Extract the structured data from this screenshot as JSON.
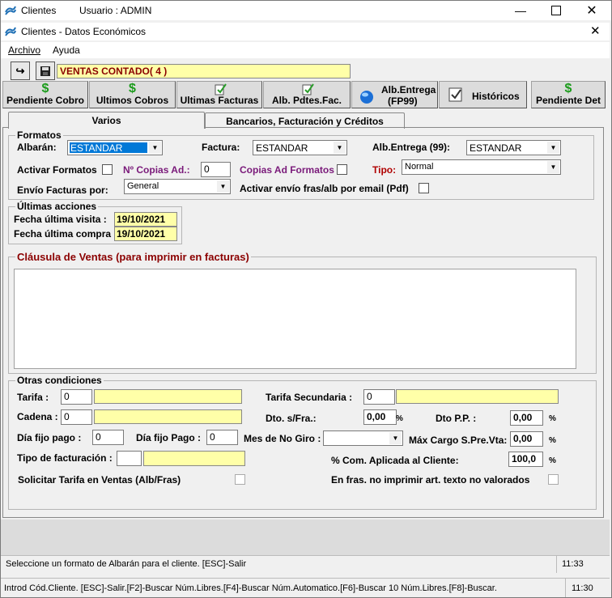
{
  "window": {
    "app_title": "Clientes",
    "user_label": "Usuario : ADMIN",
    "inner_title": "Clientes - Datos Económicos"
  },
  "menu": {
    "archivo": "Archivo",
    "ayuda": "Ayuda"
  },
  "toolbar": {
    "customer_field": "VENTAS CONTADO( 4 )",
    "buttons": {
      "pendiente_cobro": "Pendiente Cobro",
      "ultimos_cobros": "Ultimos Cobros",
      "ultimas_facturas": "Ultimas Facturas",
      "alb_pdtes_fac": "Alb. Pdtes.Fac.",
      "alb_entrega_1": "Alb.Entrega",
      "alb_entrega_2": "(FP99)",
      "historicos": "Históricos",
      "pendiente_det": "Pendiente Det"
    }
  },
  "tabs": {
    "varios": "Varios",
    "bancarios": "Bancarios, Facturación y Créditos"
  },
  "formatos": {
    "legend": "Formatos",
    "albaran_label": "Albarán:",
    "albaran_value": "ESTANDAR",
    "factura_label": "Factura:",
    "factura_value": "ESTANDAR",
    "alb_entrega_label": "Alb.Entrega (99):",
    "alb_entrega_value": "ESTANDAR",
    "activar_formatos_label": "Activar Formatos",
    "copias_label": "Nº Copias Ad.:",
    "copias_value": "0",
    "copias_formatos_label": "Copias Ad Formatos",
    "tipo_label": "Tipo:",
    "tipo_value": "Normal",
    "envio_label": "Envío Facturas por:",
    "envio_value": "General",
    "email_label": "Activar envío fras/alb por email (Pdf)"
  },
  "ultimas": {
    "legend": "Últimas acciones",
    "visita_label": "Fecha última visita :",
    "visita_value": "19/10/2021",
    "compra_label": "Fecha última compra :",
    "compra_value": "19/10/2021"
  },
  "clausula": {
    "legend": "Cláusula de Ventas (para imprimir en facturas)",
    "text": ""
  },
  "otras": {
    "legend": "Otras condiciones",
    "tarifa_label": "Tarifa :",
    "tarifa_value": "0",
    "tarifa_sec_label": "Tarifa Secundaria :",
    "tarifa_sec_value": "0",
    "cadena_label": "Cadena :",
    "cadena_value": "0",
    "dto_fra_label": "Dto. s/Fra.:",
    "dto_fra_value": "0,00",
    "dto_pp_label": "Dto P.P. :",
    "dto_pp_value": "0,00",
    "dia_fijo_pago_label": "Día fijo pago :",
    "dia_fijo_pago_value": "0",
    "dia_fijo_pago2_label": "Día fijo Pago :",
    "dia_fijo_pago2_value": "0",
    "mes_no_giro_label": "Mes de No Giro :",
    "max_cargo_label": "Máx Cargo S.Pre.Vta:",
    "max_cargo_value": "0,00",
    "tipo_fact_label": "Tipo de facturación :",
    "com_label": "% Com. Aplicada al Cliente:",
    "com_value": "100,0",
    "percent": "%",
    "solicitar_label": "Solicitar Tarifa en Ventas (Alb/Fras)",
    "no_imprimir_label": "En fras. no imprimir art. texto no valorados"
  },
  "status": {
    "inner_msg": "Seleccione un formato de Albarán para el cliente. [ESC]-Salir",
    "inner_time": "11:33",
    "outer_msg": "Introd Cód.Cliente. [ESC]-Salir.[F2]-Buscar Núm.Libres.[F4]-Buscar Núm.Automatico.[F6]-Buscar 10 Núm.Libres.[F8]-Buscar.",
    "outer_time": "11:30"
  }
}
